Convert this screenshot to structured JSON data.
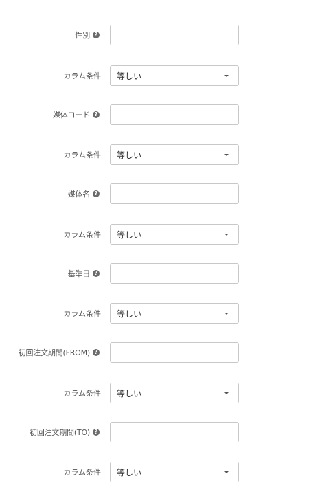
{
  "fields": [
    {
      "label": "性別",
      "help_icon": "question-circle-icon"
    },
    {
      "label": "媒体コード",
      "help_icon": "question-circle-icon"
    },
    {
      "label": "媒体名",
      "help_icon": "question-circle-icon"
    },
    {
      "label": "基準日",
      "help_icon": "question-circle-icon"
    },
    {
      "label": "初回注文期間(FROM)",
      "help_icon": "question-circle-icon"
    },
    {
      "label": "初回注文期間(TO)",
      "help_icon": "question-circle-icon"
    }
  ],
  "conditions": [
    {
      "label": "カラム条件",
      "selected": "等しい"
    },
    {
      "label": "カラム条件",
      "selected": "等しい"
    },
    {
      "label": "カラム条件",
      "selected": "等しい"
    },
    {
      "label": "カラム条件",
      "selected": "等しい"
    },
    {
      "label": "カラム条件",
      "selected": "等しい"
    },
    {
      "label": "カラム条件",
      "selected": "等しい"
    }
  ],
  "help_glyph": "?"
}
